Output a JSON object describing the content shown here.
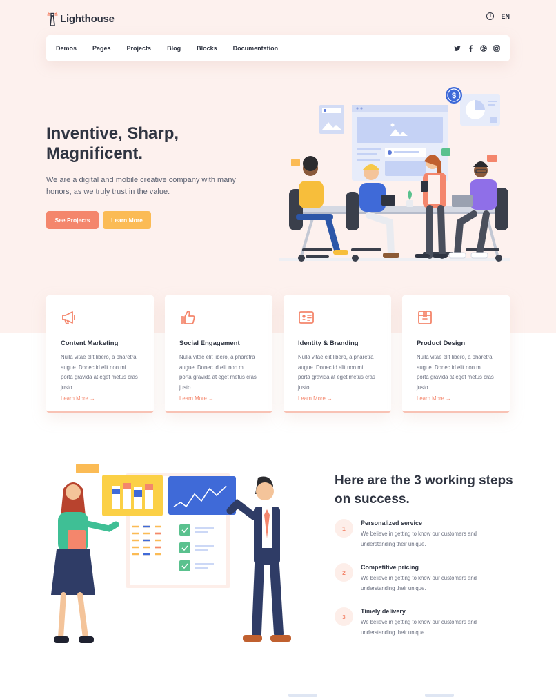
{
  "header": {
    "brand": "Lighthouse",
    "info_icon": "i",
    "language": "EN"
  },
  "nav": {
    "links": [
      "Demos",
      "Pages",
      "Projects",
      "Blog",
      "Blocks",
      "Documentation"
    ],
    "socials": [
      "twitter-icon",
      "facebook-icon",
      "dribbble-icon",
      "instagram-icon"
    ]
  },
  "hero": {
    "title": "Inventive, Sharp, Magnificent.",
    "subtitle": "We are a digital and mobile creative company with many honors, as we truly trust in the value.",
    "primary_button": "See Projects",
    "secondary_button": "Learn More"
  },
  "features": [
    {
      "icon": "megaphone-icon",
      "title": "Content Marketing",
      "text": "Nulla vitae elit libero, a pharetra augue. Donec id elit non mi porta gravida at eget metus cras justo.",
      "link": "Learn More →"
    },
    {
      "icon": "thumbs-up-icon",
      "title": "Social Engagement",
      "text": "Nulla vitae elit libero, a pharetra augue. Donec id elit non mi porta gravida at eget metus cras justo.",
      "link": "Learn More →"
    },
    {
      "icon": "id-card-icon",
      "title": "Identity & Branding",
      "text": "Nulla vitae elit libero, a pharetra augue. Donec id elit non mi porta gravida at eget metus cras justo.",
      "link": "Learn More →"
    },
    {
      "icon": "box-icon",
      "title": "Product Design",
      "text": "Nulla vitae elit libero, a pharetra augue. Donec id elit non mi porta gravida at eget metus cras justo.",
      "link": "Learn More →"
    }
  ],
  "steps": {
    "title": "Here are the 3 working steps on success.",
    "items": [
      {
        "num": "1",
        "title": "Personalized service",
        "text": "We believe in getting to know our customers and understanding their unique."
      },
      {
        "num": "2",
        "title": "Competitive pricing",
        "text": "We believe in getting to know our customers and understanding their unique."
      },
      {
        "num": "3",
        "title": "Timely delivery",
        "text": "We believe in getting to know our customers and understanding their unique."
      }
    ]
  },
  "colors": {
    "accent": "#f4866c",
    "secondary": "#fbbb55",
    "hero_bg": "#fdf1ee",
    "text": "#2f3441"
  }
}
